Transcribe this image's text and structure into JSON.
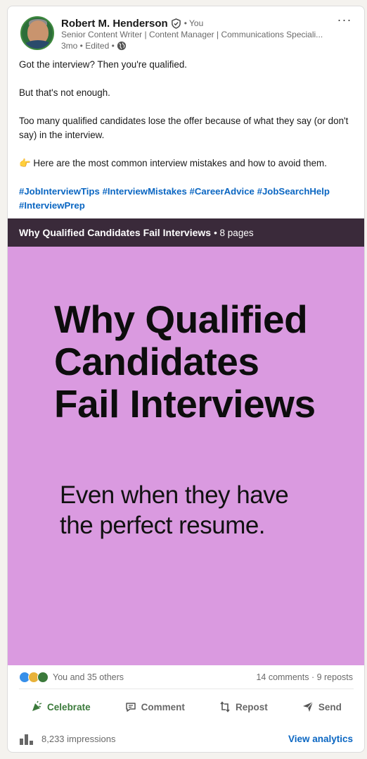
{
  "author": {
    "name": "Robert M. Henderson",
    "relation": "• You",
    "headline": "Senior Content Writer | Content Manager | Communications Speciali...",
    "meta": "3mo • Edited •",
    "avatar_badge": "#OPENTOWORK"
  },
  "post": {
    "lines": [
      "Got the interview? Then you're qualified.",
      "But that's not enough.",
      "Too many qualified candidates lose the offer because of what they say (or don't say) in the interview.",
      "👉  Here are the most common interview mistakes and how to avoid them."
    ],
    "hashtags": [
      "#JobInterviewTips",
      "#InterviewMistakes",
      "#CareerAdvice",
      "#JobSearchHelp",
      "#InterviewPrep"
    ]
  },
  "document": {
    "title": "Why Qualified Candidates Fail Interviews",
    "pages": "• 8 pages",
    "slide": {
      "title_lines": [
        "Why Qualified",
        "Candidates",
        "Fail Interviews"
      ],
      "subtitle_lines": [
        "Even when they have",
        "the perfect resume."
      ]
    }
  },
  "social": {
    "reactions_text": "You and 35 others",
    "counts": "14 comments · 9 reposts"
  },
  "actions": {
    "celebrate": "Celebrate",
    "comment": "Comment",
    "repost": "Repost",
    "send": "Send"
  },
  "analytics": {
    "impressions": "8,233 impressions",
    "view_label": "View analytics"
  },
  "colors": {
    "link": "#0a66c2",
    "slide_bg": "#da9ae0",
    "doc_bar": "#3a2a3a",
    "celebrate": "#3b7a3b"
  }
}
